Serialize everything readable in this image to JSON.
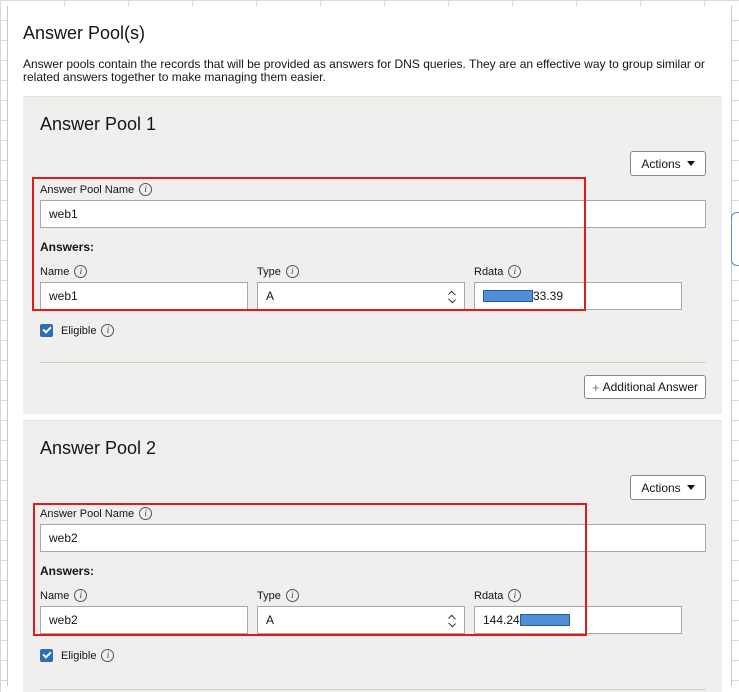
{
  "section": {
    "title": "Answer Pool(s)",
    "description": "Answer pools contain the records that will be provided as answers for DNS queries. They are an effective way to group similar or related answers together to make managing them easier."
  },
  "pools": [
    {
      "title": "Answer Pool 1",
      "actions_label": "Actions",
      "name_label": "Answer Pool Name",
      "name_value": "web1",
      "answers_label": "Answers:",
      "col_name_label": "Name",
      "col_type_label": "Type",
      "col_rdata_label": "Rdata",
      "answer_name": "web1",
      "answer_type": "A",
      "answer_rdata_visible": "33.39",
      "eligible_label": "Eligible",
      "eligible_checked": true,
      "add_answer_label": "Additional Answer"
    },
    {
      "title": "Answer Pool 2",
      "actions_label": "Actions",
      "name_label": "Answer Pool Name",
      "name_value": "web2",
      "answers_label": "Answers:",
      "col_name_label": "Name",
      "col_type_label": "Type",
      "col_rdata_label": "Rdata",
      "answer_name": "web2",
      "answer_type": "A",
      "answer_rdata_visible": "144.24",
      "eligible_label": "Eligible",
      "eligible_checked": true
    }
  ],
  "colors": {
    "highlight": "#e01b1b",
    "redaction": "#4e8fd8",
    "checkbox": "#2d6fb5",
    "pool_background": "#f1efed"
  },
  "icons": [
    "info-icon",
    "chevron-down-icon",
    "select-arrows-icon",
    "checkmark-icon",
    "plus-icon"
  ]
}
